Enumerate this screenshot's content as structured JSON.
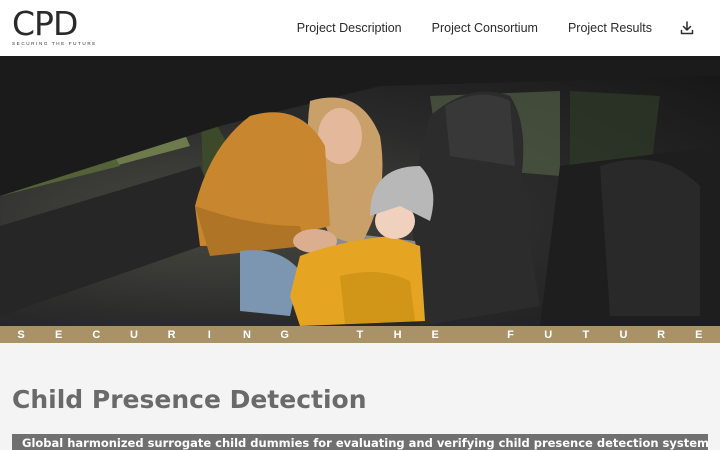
{
  "header": {
    "logo_mark": "CPD",
    "logo_tagline": "SECURING THE FUTURE",
    "nav": [
      {
        "label": "Project Description"
      },
      {
        "label": "Project Consortium"
      },
      {
        "label": "Project Results"
      }
    ],
    "download_icon": "download-icon"
  },
  "hero": {
    "image": "mother-fastening-child-seatbelt-photo"
  },
  "strip": {
    "letters": [
      "S",
      "E",
      "C",
      "U",
      "R",
      "I",
      "N",
      "G",
      "",
      "T",
      "H",
      "E",
      "",
      "F",
      "U",
      "T",
      "U",
      "R",
      "E"
    ]
  },
  "main": {
    "title": "Child Presence Detection",
    "subtitle": "Global harmonized surrogate child dummies for evaluating and verifying child presence detection systems"
  },
  "colors": {
    "header_bg": "#ffffff",
    "strip_gold": "#a99267",
    "title_gray": "#6a6a6a",
    "subtitle_bar": "#707070",
    "page_bg": "#f4f4f4"
  }
}
